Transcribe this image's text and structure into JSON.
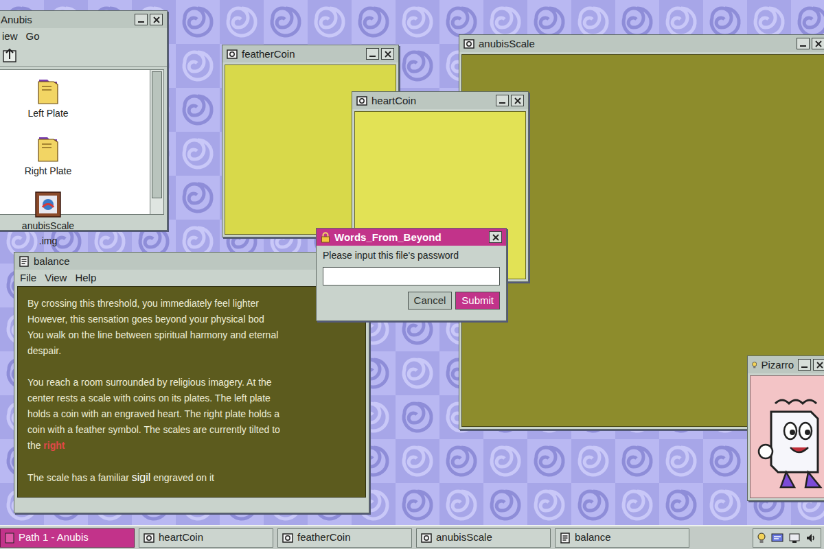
{
  "explorer": {
    "title": "Anubis",
    "menu": [
      "iew",
      "Go"
    ],
    "items": [
      {
        "label": [
          "Left Plate"
        ],
        "kind": "folder"
      },
      {
        "label": [
          "Right Plate"
        ],
        "kind": "folder"
      },
      {
        "label": [
          "anubisScale",
          ".img"
        ],
        "kind": "image"
      }
    ]
  },
  "feather_window": {
    "title": "featherCoin"
  },
  "heart_window": {
    "title": "heartCoin"
  },
  "scale_window": {
    "title": "anubisScale"
  },
  "balance": {
    "title": "balance",
    "menu": [
      "File",
      "View",
      "Help"
    ],
    "paragraphs": [
      [
        [
          {
            "text": "By crossing this threshold, you immediately feel lighter",
            "kind": "plain"
          }
        ],
        [
          {
            "text": "However, this sensation goes beyond your physical bod",
            "kind": "plain"
          }
        ],
        [
          {
            "text": "You walk on the line between spiritual harmony and eternal",
            "kind": "plain"
          }
        ],
        [
          {
            "text": "despair.",
            "kind": "plain"
          }
        ]
      ],
      [
        [
          {
            "text": "You reach a room surrounded by religious imagery. At the",
            "kind": "plain"
          }
        ],
        [
          {
            "text": "center rests a scale with coins on its plates. The left plate",
            "kind": "plain"
          }
        ],
        [
          {
            "text": "holds a coin with an engraved heart. The right plate holds a",
            "kind": "plain"
          }
        ],
        [
          {
            "text": "coin with a feather symbol. The scales are currently tilted to",
            "kind": "plain"
          }
        ],
        [
          {
            "text": "the ",
            "kind": "plain"
          },
          {
            "text": "right",
            "kind": "keyword"
          }
        ]
      ],
      [
        [
          {
            "text": "The scale has a familiar ",
            "kind": "plain"
          },
          {
            "text": "sigil",
            "kind": "sigil"
          },
          {
            "text": " engraved on it",
            "kind": "plain"
          }
        ]
      ]
    ]
  },
  "dialog": {
    "title": "Words_From_Beyond",
    "active": true,
    "prompt": "Please input this file's password",
    "value": "",
    "buttons": [
      {
        "label": "Cancel",
        "primary": false
      },
      {
        "label": "Submit",
        "primary": true
      }
    ]
  },
  "pizarro": {
    "title": "Pizarro"
  },
  "taskbar": {
    "items": [
      {
        "label": "Path 1 - Anubis",
        "selected": true,
        "kind": "path"
      },
      {
        "label": "heartCoin",
        "selected": false,
        "kind": "image"
      },
      {
        "label": "featherCoin",
        "selected": false,
        "kind": "image"
      },
      {
        "label": "anubisScale",
        "selected": false,
        "kind": "image"
      },
      {
        "label": "balance",
        "selected": false,
        "kind": "text"
      }
    ]
  }
}
